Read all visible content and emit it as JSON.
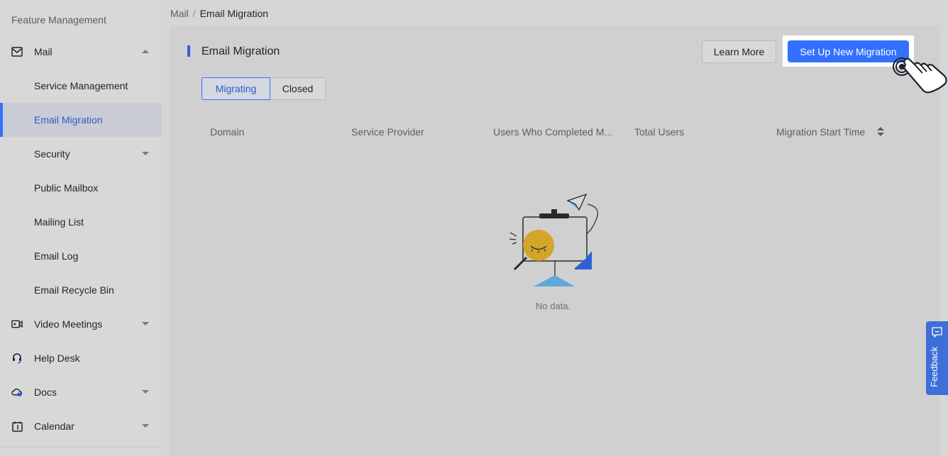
{
  "sidebar": {
    "title": "Feature Management",
    "items": [
      {
        "label": "Mail",
        "icon": "mail-icon"
      },
      {
        "label": "Service Management"
      },
      {
        "label": "Email Migration"
      },
      {
        "label": "Security"
      },
      {
        "label": "Public Mailbox"
      },
      {
        "label": "Mailing List"
      },
      {
        "label": "Email Log"
      },
      {
        "label": "Email Recycle Bin"
      },
      {
        "label": "Video Meetings",
        "icon": "video-icon"
      },
      {
        "label": "Help Desk",
        "icon": "headset-icon"
      },
      {
        "label": "Docs",
        "icon": "cloud-doc-icon"
      },
      {
        "label": "Calendar",
        "icon": "calendar-icon"
      }
    ]
  },
  "breadcrumb": {
    "parent": "Mail",
    "separator": "/",
    "current": "Email Migration"
  },
  "page": {
    "title": "Email Migration",
    "learn_more": "Learn More",
    "new_migration": "Set Up New Migration",
    "tabs": [
      "Migrating",
      "Closed"
    ],
    "columns": [
      "Domain",
      "Service Provider",
      "Users Who Completed M...",
      "Total Users",
      "Migration Start Time"
    ],
    "empty_text": "No data."
  },
  "feedback": {
    "label": "Feedback"
  },
  "colors": {
    "accent": "#3370ff",
    "sidebar_active": "#c9ccd6"
  }
}
